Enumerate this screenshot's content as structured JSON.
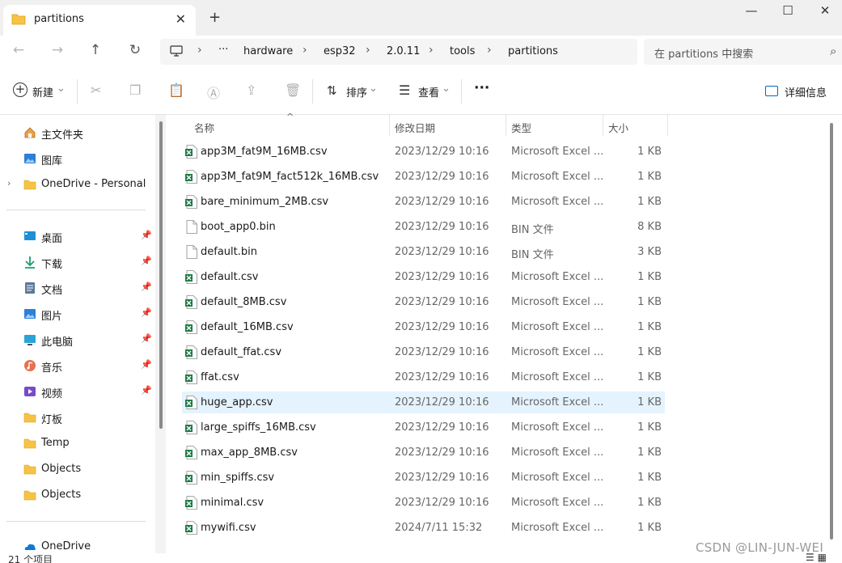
{
  "tab": {
    "title": "partitions",
    "close": "✕",
    "new": "+"
  },
  "window": {
    "minimize": "—",
    "maximize": "☐",
    "close": "✕"
  },
  "nav": {
    "back": "←",
    "forward": "→",
    "up": "↑",
    "refresh": "↻"
  },
  "breadcrumb": {
    "computer_icon": "▭",
    "overflow": "···",
    "items": [
      "hardware",
      "esp32",
      "2.0.11",
      "tools",
      "partitions"
    ],
    "separator": "›"
  },
  "search": {
    "placeholder": "在 partitions 中搜索",
    "icon": "⌕"
  },
  "toolbar": {
    "new_label": "新建",
    "sort_label": "排序",
    "view_label": "查看",
    "more": "···",
    "details_label": "详细信息",
    "dropdown": "⌄"
  },
  "sidebar": {
    "top": [
      {
        "label": "主文件夹",
        "icon": "home-icon"
      },
      {
        "label": "图库",
        "icon": "gallery-icon"
      },
      {
        "label": "OneDrive - Personal",
        "icon": "folder-icon",
        "expander": "›"
      }
    ],
    "pinned": [
      {
        "label": "桌面",
        "icon": "desktop-icon",
        "pin": "📌"
      },
      {
        "label": "下载",
        "icon": "download-icon",
        "pin": "📌"
      },
      {
        "label": "文档",
        "icon": "document-icon",
        "pin": "📌"
      },
      {
        "label": "图片",
        "icon": "pictures-icon",
        "pin": "📌"
      },
      {
        "label": "此电脑",
        "icon": "computer-icon",
        "pin": "📌"
      },
      {
        "label": "音乐",
        "icon": "music-icon",
        "pin": "📌"
      },
      {
        "label": "视频",
        "icon": "video-icon",
        "pin": "📌"
      },
      {
        "label": "灯板",
        "icon": "folder-icon"
      },
      {
        "label": "Temp",
        "icon": "folder-icon"
      },
      {
        "label": "Objects",
        "icon": "folder-icon"
      },
      {
        "label": "Objects",
        "icon": "folder-icon"
      }
    ],
    "bottom": [
      {
        "label": "OneDrive",
        "icon": "onedrive-icon"
      }
    ]
  },
  "columns": {
    "name": "名称",
    "date": "修改日期",
    "type": "类型",
    "size": "大小",
    "sort_arrow": "^"
  },
  "files": [
    {
      "name": "app3M_fat9M_16MB.csv",
      "date": "2023/12/29 10:16",
      "type": "Microsoft Excel ...",
      "size": "1 KB",
      "kind": "excel"
    },
    {
      "name": "app3M_fat9M_fact512k_16MB.csv",
      "date": "2023/12/29 10:16",
      "type": "Microsoft Excel ...",
      "size": "1 KB",
      "kind": "excel"
    },
    {
      "name": "bare_minimum_2MB.csv",
      "date": "2023/12/29 10:16",
      "type": "Microsoft Excel ...",
      "size": "1 KB",
      "kind": "excel"
    },
    {
      "name": "boot_app0.bin",
      "date": "2023/12/29 10:16",
      "type": "BIN 文件",
      "size": "8 KB",
      "kind": "bin"
    },
    {
      "name": "default.bin",
      "date": "2023/12/29 10:16",
      "type": "BIN 文件",
      "size": "3 KB",
      "kind": "bin"
    },
    {
      "name": "default.csv",
      "date": "2023/12/29 10:16",
      "type": "Microsoft Excel ...",
      "size": "1 KB",
      "kind": "excel"
    },
    {
      "name": "default_8MB.csv",
      "date": "2023/12/29 10:16",
      "type": "Microsoft Excel ...",
      "size": "1 KB",
      "kind": "excel"
    },
    {
      "name": "default_16MB.csv",
      "date": "2023/12/29 10:16",
      "type": "Microsoft Excel ...",
      "size": "1 KB",
      "kind": "excel"
    },
    {
      "name": "default_ffat.csv",
      "date": "2023/12/29 10:16",
      "type": "Microsoft Excel ...",
      "size": "1 KB",
      "kind": "excel"
    },
    {
      "name": "ffat.csv",
      "date": "2023/12/29 10:16",
      "type": "Microsoft Excel ...",
      "size": "1 KB",
      "kind": "excel"
    },
    {
      "name": "huge_app.csv",
      "date": "2023/12/29 10:16",
      "type": "Microsoft Excel ...",
      "size": "1 KB",
      "kind": "excel",
      "selected": true
    },
    {
      "name": "large_spiffs_16MB.csv",
      "date": "2023/12/29 10:16",
      "type": "Microsoft Excel ...",
      "size": "1 KB",
      "kind": "excel"
    },
    {
      "name": "max_app_8MB.csv",
      "date": "2023/12/29 10:16",
      "type": "Microsoft Excel ...",
      "size": "1 KB",
      "kind": "excel"
    },
    {
      "name": "min_spiffs.csv",
      "date": "2023/12/29 10:16",
      "type": "Microsoft Excel ...",
      "size": "1 KB",
      "kind": "excel"
    },
    {
      "name": "minimal.csv",
      "date": "2023/12/29 10:16",
      "type": "Microsoft Excel ...",
      "size": "1 KB",
      "kind": "excel"
    },
    {
      "name": "mywifi.csv",
      "date": "2024/7/11 15:32",
      "type": "Microsoft Excel ...",
      "size": "1 KB",
      "kind": "excel"
    }
  ],
  "status": {
    "count": "21 个项目"
  },
  "watermark": "CSDN @LIN-JUN-WEI",
  "colors": {
    "selected_row": "#e5f3ff",
    "folder": "#f6c344",
    "excel": "#1d7a45",
    "accent": "#0067c0"
  }
}
